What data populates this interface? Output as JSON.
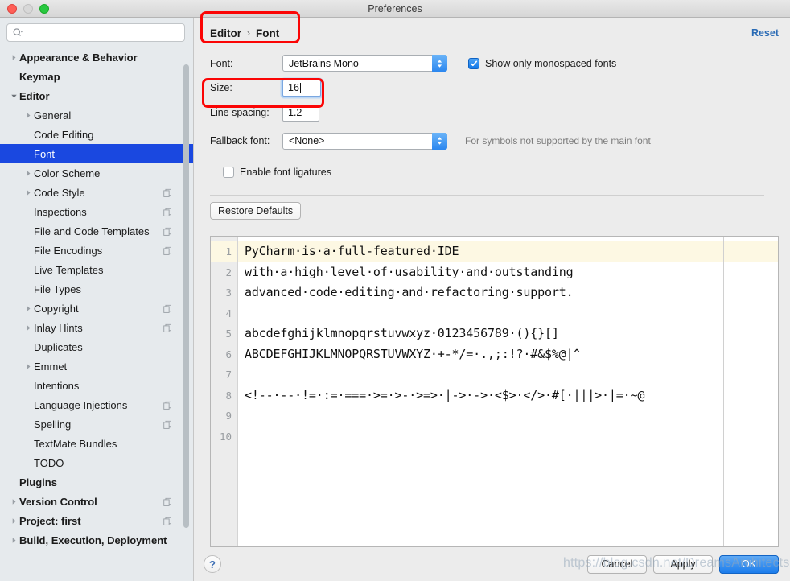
{
  "window": {
    "title": "Preferences",
    "traffic_lights": [
      "close-red",
      "minimize-gray",
      "zoom-green"
    ]
  },
  "sidebar": {
    "search": {
      "value": "",
      "placeholder": "",
      "icon": "search-icon"
    },
    "items": [
      {
        "label": "Appearance & Behavior",
        "indent": 0,
        "twisty": "collapsed",
        "bold": true,
        "copy": false,
        "selected": false
      },
      {
        "label": "Keymap",
        "indent": 0,
        "twisty": "none",
        "bold": true,
        "copy": false,
        "selected": false
      },
      {
        "label": "Editor",
        "indent": 0,
        "twisty": "expanded",
        "bold": true,
        "copy": false,
        "selected": false
      },
      {
        "label": "General",
        "indent": 1,
        "twisty": "collapsed",
        "bold": false,
        "copy": false,
        "selected": false
      },
      {
        "label": "Code Editing",
        "indent": 1,
        "twisty": "none",
        "bold": false,
        "copy": false,
        "selected": false
      },
      {
        "label": "Font",
        "indent": 1,
        "twisty": "none",
        "bold": false,
        "copy": false,
        "selected": true
      },
      {
        "label": "Color Scheme",
        "indent": 1,
        "twisty": "collapsed",
        "bold": false,
        "copy": false,
        "selected": false
      },
      {
        "label": "Code Style",
        "indent": 1,
        "twisty": "collapsed",
        "bold": false,
        "copy": true,
        "selected": false
      },
      {
        "label": "Inspections",
        "indent": 1,
        "twisty": "none",
        "bold": false,
        "copy": true,
        "selected": false
      },
      {
        "label": "File and Code Templates",
        "indent": 1,
        "twisty": "none",
        "bold": false,
        "copy": true,
        "selected": false
      },
      {
        "label": "File Encodings",
        "indent": 1,
        "twisty": "none",
        "bold": false,
        "copy": true,
        "selected": false
      },
      {
        "label": "Live Templates",
        "indent": 1,
        "twisty": "none",
        "bold": false,
        "copy": false,
        "selected": false
      },
      {
        "label": "File Types",
        "indent": 1,
        "twisty": "none",
        "bold": false,
        "copy": false,
        "selected": false
      },
      {
        "label": "Copyright",
        "indent": 1,
        "twisty": "collapsed",
        "bold": false,
        "copy": true,
        "selected": false
      },
      {
        "label": "Inlay Hints",
        "indent": 1,
        "twisty": "collapsed",
        "bold": false,
        "copy": true,
        "selected": false
      },
      {
        "label": "Duplicates",
        "indent": 1,
        "twisty": "none",
        "bold": false,
        "copy": false,
        "selected": false
      },
      {
        "label": "Emmet",
        "indent": 1,
        "twisty": "collapsed",
        "bold": false,
        "copy": false,
        "selected": false
      },
      {
        "label": "Intentions",
        "indent": 1,
        "twisty": "none",
        "bold": false,
        "copy": false,
        "selected": false
      },
      {
        "label": "Language Injections",
        "indent": 1,
        "twisty": "none",
        "bold": false,
        "copy": true,
        "selected": false
      },
      {
        "label": "Spelling",
        "indent": 1,
        "twisty": "none",
        "bold": false,
        "copy": true,
        "selected": false
      },
      {
        "label": "TextMate Bundles",
        "indent": 1,
        "twisty": "none",
        "bold": false,
        "copy": false,
        "selected": false
      },
      {
        "label": "TODO",
        "indent": 1,
        "twisty": "none",
        "bold": false,
        "copy": false,
        "selected": false
      },
      {
        "label": "Plugins",
        "indent": 0,
        "twisty": "none",
        "bold": true,
        "copy": false,
        "selected": false
      },
      {
        "label": "Version Control",
        "indent": 0,
        "twisty": "collapsed",
        "bold": true,
        "copy": true,
        "selected": false
      },
      {
        "label": "Project: first",
        "indent": 0,
        "twisty": "collapsed",
        "bold": true,
        "copy": true,
        "selected": false
      },
      {
        "label": "Build, Execution, Deployment",
        "indent": 0,
        "twisty": "collapsed",
        "bold": true,
        "copy": false,
        "selected": false
      }
    ]
  },
  "breadcrumb": {
    "parent": "Editor",
    "separator": "›",
    "current": "Font"
  },
  "reset_label": "Reset",
  "form": {
    "font_label": "Font:",
    "font_value": "JetBrains Mono",
    "monospace_checkbox": {
      "label": "Show only monospaced fonts",
      "checked": true
    },
    "size_label": "Size:",
    "size_value": "16",
    "line_spacing_label": "Line spacing:",
    "line_spacing_value": "1.2",
    "fallback_label": "Fallback font:",
    "fallback_value": "<None>",
    "fallback_hint": "For symbols not supported by the main font",
    "ligatures_checkbox": {
      "label": "Enable font ligatures",
      "checked": false
    },
    "restore_defaults_label": "Restore Defaults"
  },
  "preview": {
    "line_numbers": [
      "1",
      "2",
      "3",
      "4",
      "5",
      "6",
      "7",
      "8",
      "9",
      "10"
    ],
    "current_line": 1,
    "lines": [
      "PyCharm·is·a·full-featured·IDE",
      "with·a·high·level·of·usability·and·outstanding",
      "advanced·code·editing·and·refactoring·support.",
      "",
      "abcdefghijklmnopqrstuvwxyz·0123456789·(){}[]",
      "ABCDEFGHIJKLMNOPQRSTUVWXYZ·+-*/=·.,;:!?·#&$%@|^",
      "",
      "<!--·--·!=·:=·===·>=·>-·>=>·|->·->·<$>·</>·#[·|||>·|=·~@",
      "",
      ""
    ]
  },
  "footer": {
    "help_label": "?",
    "cancel_label": "Cancel",
    "apply_label": "Apply",
    "ok_label": "OK"
  },
  "watermark": "https://blog.csdn.net/DreamsArchitects",
  "colors": {
    "selection_blue": "#1a48e0",
    "accent_blue": "#1b7cec",
    "link_blue": "#2a6bb5",
    "annotation_red": "#fb0505",
    "current_line": "#fdf8e3",
    "sidebar_bg": "#e6eaed"
  }
}
